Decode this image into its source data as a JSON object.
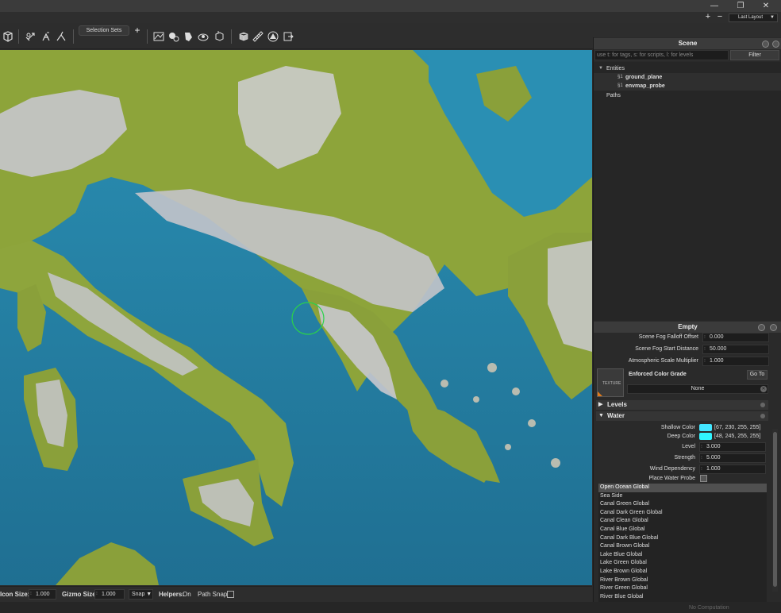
{
  "window": {
    "controls": {
      "minimize": "—",
      "restore": "❐",
      "close": "✕"
    }
  },
  "layout_bar": {
    "add": "+",
    "remove": "−",
    "layout_name": "Last Layout",
    "caret": "▼"
  },
  "toolbar": {
    "selection_sets": "Selection Sets",
    "add": "+"
  },
  "status": {
    "icon_size_label": "Icon Size:",
    "icon_size_value": "1.000",
    "gizmo_size_label": "Gizmo Size",
    "gizmo_size_value": "1.000",
    "snap_label": "Snap ▼",
    "helpers_label": "Helpers:",
    "helpers_value": "On",
    "path_snap_label": "Path Snap",
    "no_computation": "No Computation"
  },
  "scene": {
    "title": "Scene",
    "search_placeholder": "use t: for tags, s: for scripts, l: for levels",
    "filter_label": "Filter",
    "entities_label": "Entities",
    "items": [
      {
        "icon": "§1",
        "label": "ground_plane"
      },
      {
        "icon": "§1",
        "label": "envmap_probe"
      }
    ],
    "paths_label": "Paths"
  },
  "empty": {
    "title": "Empty",
    "props": [
      {
        "label": "Scene Fog Falloff Offset",
        "value": "0.000"
      },
      {
        "label": "Scene Fog Start Distance",
        "value": "50.000"
      },
      {
        "label": "Atmospheric Scale Multiplier",
        "value": "1.000"
      }
    ],
    "texture_label": "TEXTURE",
    "color_grade_label": "Enforced Color Grade",
    "goto_label": "Go To",
    "color_grade_value": "None",
    "levels_label": "Levels",
    "water_label": "Water",
    "shallow_color_label": "Shallow Color",
    "shallow_color_value": "[67, 230, 255, 255]",
    "deep_color_label": "Deep Color",
    "deep_color_value": "[48, 245, 255, 255]",
    "level_label": "Level",
    "level_value": "3.000",
    "strength_label": "Strength",
    "strength_value": "5.000",
    "wind_label": "Wind Dependency",
    "wind_value": "1.000",
    "place_probe_label": "Place Water Probe",
    "water_presets": [
      "Open Ocean Global",
      "Sea Side",
      "Canal Green Global",
      "Canal Dark Green Global",
      "Canal Clean Global",
      "Canal Blue Global",
      "Canal Dark Blue Global",
      "Canal Brown Global",
      "Lake Blue Global",
      "Lake Green Global",
      "Lake Brown Global",
      "River Brown Global",
      "River Green Global",
      "River Blue Global"
    ]
  },
  "colors": {
    "shallow": "#43e6ff",
    "deep": "#30f5ff",
    "water": "#2b86a8",
    "land": "#8fa63c",
    "mountain": "#c9c9cf"
  }
}
